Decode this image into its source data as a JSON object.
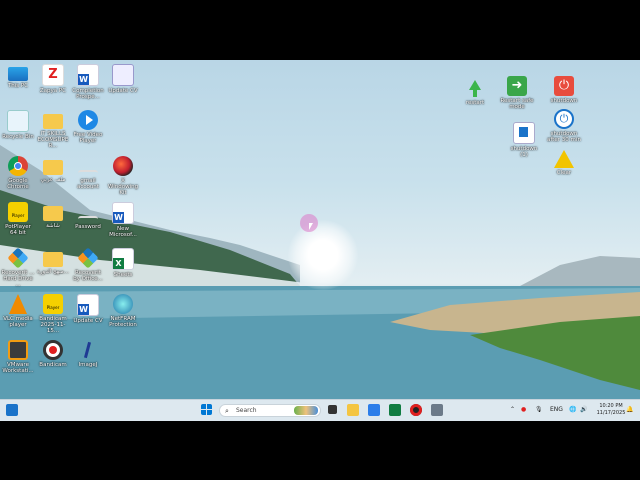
{
  "desktop": {
    "icons_left": [
      {
        "label": "This PC",
        "icon": "pc-icon"
      },
      {
        "label": "Zapya PC",
        "icon": "zapya-icon"
      },
      {
        "label": "Completion Prospe...",
        "icon": "word-doc-icon"
      },
      {
        "label": "Update CV",
        "icon": "update-icon"
      },
      {
        "label": "Recycle Bin",
        "icon": "recycle-bin-icon"
      },
      {
        "label": "IT SKILLS ECOMSUPER...",
        "icon": "folder-icon"
      },
      {
        "label": "Free Video Player",
        "icon": "video-player-icon"
      },
      {
        "label": "Google Chrome",
        "icon": "chrome-icon"
      },
      {
        "label": "ملف عربي",
        "icon": "folder-icon"
      },
      {
        "label": "gmail account",
        "icon": "text-file-icon"
      },
      {
        "label": "X Windowing Kit",
        "icon": "xlive-icon"
      },
      {
        "label": "PotPlayer 64 bit",
        "icon": "potplayer-icon"
      },
      {
        "label": "شاشة",
        "icon": "folder-icon"
      },
      {
        "label": "Password",
        "icon": "text-file-icon"
      },
      {
        "label": "New Microsof...",
        "icon": "word-doc-icon"
      },
      {
        "label": "Recoverit ... Hard Drive ...",
        "icon": "recoverit-icon"
      },
      {
        "label": "منهج الدورة...",
        "icon": "folder-icon"
      },
      {
        "label": "Recoverit by Office...",
        "icon": "recoverit-icon"
      },
      {
        "label": "Sheets",
        "icon": "excel-icon"
      },
      {
        "label": "VLC media player",
        "icon": "vlc-icon"
      },
      {
        "label": "Bandicam 2025-11-15...",
        "icon": "potplayer-icon"
      },
      {
        "label": "Update CV",
        "icon": "word-doc-icon"
      },
      {
        "label": "NetFRAM Protection",
        "icon": "network-icon"
      },
      {
        "label": "VMware Workstati...",
        "icon": "vmware-icon"
      },
      {
        "label": "Bandicam",
        "icon": "bandicam-icon"
      },
      {
        "label": "ImageJ",
        "icon": "imagej-icon"
      }
    ],
    "icons_right": [
      {
        "label": "restart",
        "icon": "restart-icon"
      },
      {
        "label": "Restart safe mode",
        "icon": "restart-safe-icon"
      },
      {
        "label": "shutdown",
        "icon": "shutdown-icon"
      },
      {
        "label": "shutdown after 30 min",
        "icon": "shutdown-timer-icon"
      },
      {
        "label": "shutdown (1)",
        "icon": "shutdown-file-icon"
      },
      {
        "label": "Clear",
        "icon": "warning-icon"
      }
    ]
  },
  "taskbar": {
    "search_placeholder": "Search",
    "language": "ENG",
    "time": "10:20 PM",
    "date": "11/17/2025"
  },
  "colors": {
    "taskbar_bg": "#dde8ef",
    "sky_top": "#b9d6e6",
    "water": "#5c9cb2"
  }
}
